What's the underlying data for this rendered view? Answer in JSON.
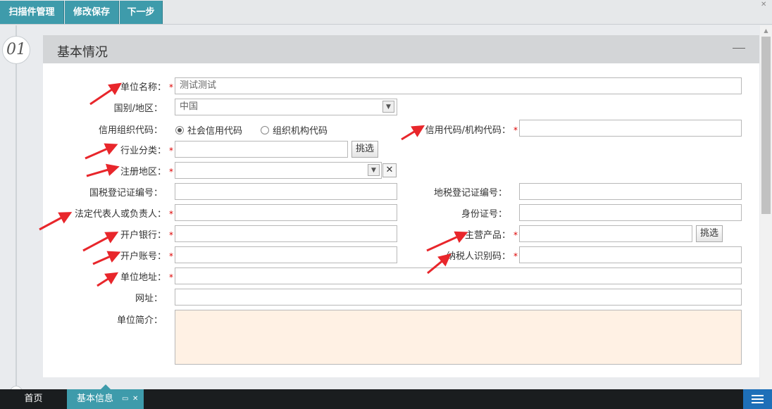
{
  "toolbar": {
    "scan_label": "扫描件管理",
    "save_label": "修改保存",
    "next_label": "下一步"
  },
  "step": {
    "number": "01"
  },
  "panel": {
    "title": "基本情况"
  },
  "form": {
    "unit_name": {
      "label": "单位名称：",
      "value": "测试测试",
      "required": "*"
    },
    "country": {
      "label": "国别/地区：",
      "value": "中国"
    },
    "credit_org_code": {
      "label": "信用组织代码：",
      "opt1": "社会信用代码",
      "opt2": "组织机构代码"
    },
    "credit_code": {
      "label": "信用代码/机构代码：",
      "required": "*"
    },
    "industry": {
      "label": "行业分类：",
      "required": "*",
      "pick": "挑选"
    },
    "reg_area": {
      "label": "注册地区：",
      "required": "*",
      "clear": "✕"
    },
    "national_tax": {
      "label": "国税登记证编号："
    },
    "local_tax": {
      "label": "地税登记证编号："
    },
    "legal_rep": {
      "label": "法定代表人或负责人：",
      "required": "*"
    },
    "id_number": {
      "label": "身份证号："
    },
    "bank": {
      "label": "开户银行：",
      "required": "*"
    },
    "main_product": {
      "label": "主营产品：",
      "required": "*",
      "pick": "挑选"
    },
    "account": {
      "label": "开户账号：",
      "required": "*"
    },
    "taxpayer_id": {
      "label": "纳税人识别码：",
      "required": "*"
    },
    "address": {
      "label": "单位地址：",
      "required": "*"
    },
    "website": {
      "label": "网址："
    },
    "intro": {
      "label": "单位简介："
    }
  },
  "tabs": {
    "home": "首页",
    "active": "基本信息"
  },
  "colors": {
    "accent": "#3e9bab",
    "arrow": "#e8262b",
    "intro_bg": "#fff1e4",
    "menu": "#1e6fb8"
  }
}
